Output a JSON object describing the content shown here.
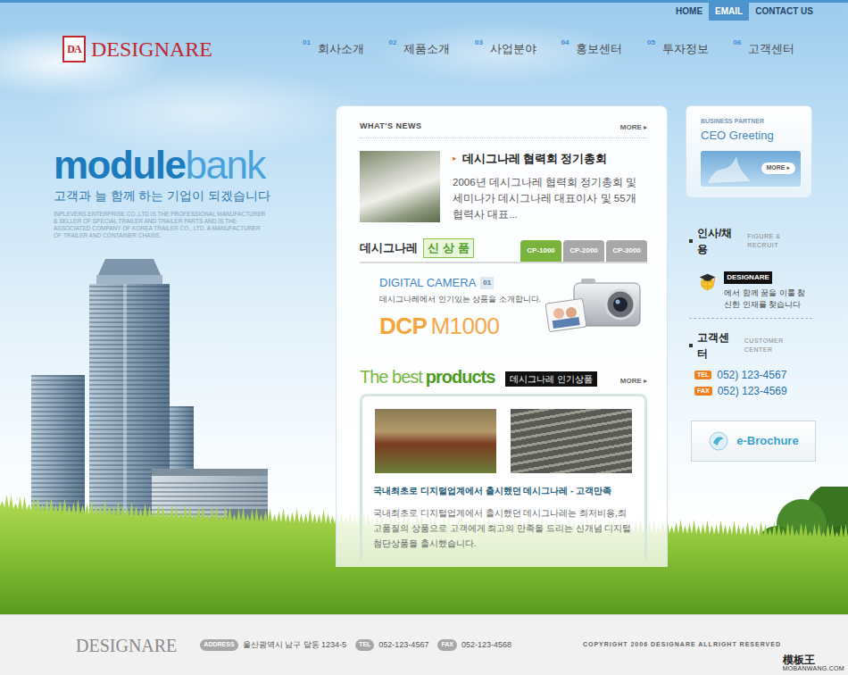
{
  "topbar": {
    "links": [
      {
        "label": "HOME",
        "selected": false
      },
      {
        "label": "EMAIL",
        "selected": true
      },
      {
        "label": "CONTACT US",
        "selected": false
      }
    ]
  },
  "logo": {
    "mark": "DA",
    "name": "DESIGNARE"
  },
  "nav": [
    {
      "number": "01",
      "label": "회사소개"
    },
    {
      "number": "02",
      "label": "제품소개"
    },
    {
      "number": "03",
      "label": "사업분야"
    },
    {
      "number": "04",
      "label": "홍보센터"
    },
    {
      "number": "05",
      "label": "투자정보"
    },
    {
      "number": "06",
      "label": "고객센터"
    }
  ],
  "hero": {
    "title_bold": "module",
    "title_light": "bank",
    "slogan": "고객과 늘 함께 하는 기업이 되겠습니다",
    "description": "INPLEVERS ENTERPRISE CO.,LTD IS THE PROFESSIONAL MANUFACTURER & SELLER OF SPECIAL TRAILER AND TRAILER PARTS AND IS THE ASSOCIATED COMPANY OF KOREA TRAILER CO., LTD. A MANUFACTURER OF TRAILER AND CONTAINER CHASIS."
  },
  "news": {
    "heading": "WHAT'S NEWS",
    "more": "MORE ▸",
    "bullet": "▸",
    "title": "데시그나레 협력회 정기총회",
    "body": "2006년 데시그나레 협력회 정기총회 및 세미나가 데시그나레 대표이사 및 55개 협력사 대표..."
  },
  "new_products": {
    "title": "데시그나레",
    "highlight": "신상품",
    "tabs": [
      {
        "label": "CP-1000",
        "selected": true
      },
      {
        "label": "CP-2000",
        "selected": false
      },
      {
        "label": "CP-3000",
        "selected": false
      }
    ],
    "category": "DIGITAL CAMERA",
    "number": "01",
    "description": "데시그나레에서 인기있는 상품을 소개합니다.",
    "model_prefix": "DCP",
    "model_name": "M1000"
  },
  "best": {
    "title_light": "The best",
    "title_bold": "products",
    "tag": "데시그나레 인기상품",
    "more": "MORE ▸",
    "caption": "국내최초로 디지털업계에서 출시했던 데시그나레 - 고객만족",
    "description": "국내최초로 디지털업계에서 출시했던 데시그나레는 최저비용,최고품질의 상품으로 고객에게 최고의 만족을 드리는 신개념 디지털 첨단상품을 출시했습니다."
  },
  "ceo": {
    "kicker": "BUSINESS PARTNER",
    "title": "CEO Greeting",
    "more": "MORE ▸"
  },
  "recruit": {
    "title": "인사/채용",
    "subtitle": "FIGURE & RECRUIT",
    "badge": "DESIGNARE",
    "text": "에서 함께 꿈을 이룰 참신한 인재를 찾습니다"
  },
  "customer": {
    "title": "고객센터",
    "subtitle": "CUSTOMER CENTER",
    "contacts": [
      {
        "label": "TEL",
        "number": "052) 123-4567"
      },
      {
        "label": "FAX",
        "number": "052) 123-4569"
      }
    ]
  },
  "brochure": {
    "label": "e-Brochure"
  },
  "footer": {
    "logo": "DESIGNARE",
    "items": [
      {
        "label": "ADDRESS",
        "value": "울산광역시 남구 달동 1234-5"
      },
      {
        "label": "TEL",
        "value": "052-123-4567"
      },
      {
        "label": "FAX",
        "value": "052-123-4568"
      }
    ],
    "copyright": "COPYRIGHT 2006 DESIGNARE ALLRIGHT RESERVED"
  },
  "watermark": {
    "brand": "模板王",
    "site": "MOBANWANG.COM"
  }
}
